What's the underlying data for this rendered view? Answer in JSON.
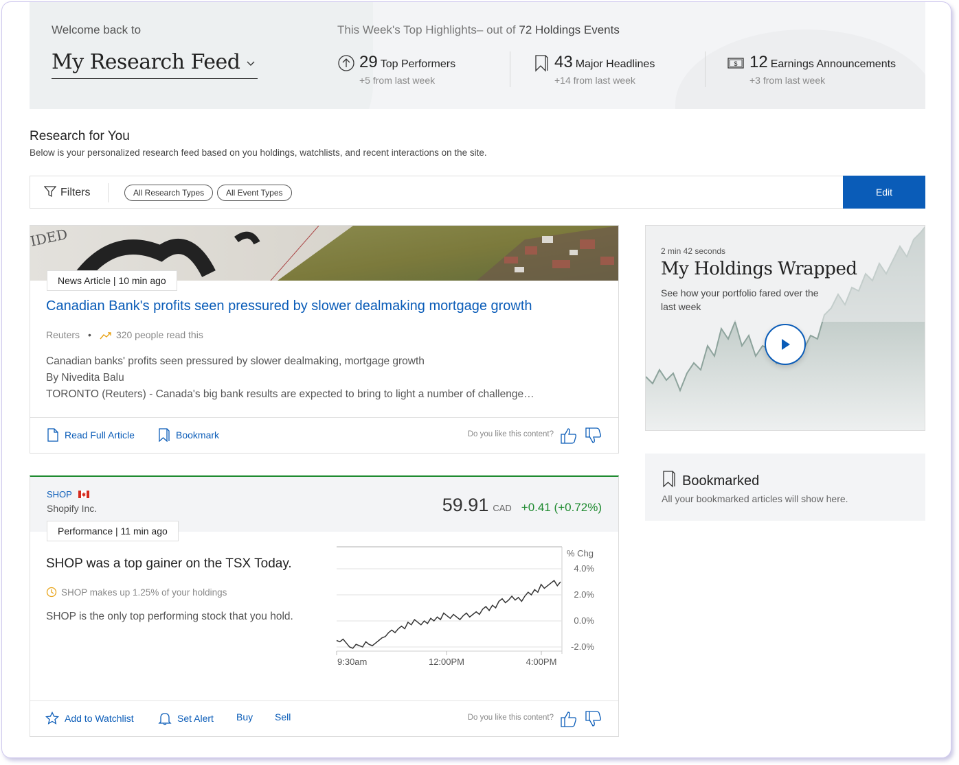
{
  "header": {
    "welcome": "Welcome back to",
    "feed_title": "My Research Feed",
    "highlights_prefix": "This Week's Top Highlights– out of",
    "highlights_count": "72 Holdings Events",
    "stats": [
      {
        "icon": "arrow-up-circle-icon",
        "number": "29",
        "label": "Top Performers",
        "sub": "+5 from last week"
      },
      {
        "icon": "bookmark-icon",
        "number": "43",
        "label": "Major Headlines",
        "sub": "+14 from last week"
      },
      {
        "icon": "dollar-bill-icon",
        "number": "12",
        "label": "Earnings Announcements",
        "sub": "+3 from last week"
      }
    ]
  },
  "research": {
    "title": "Research for You",
    "description": "Below is your personalized research feed based on you holdings, watchlists, and recent interactions on the site."
  },
  "filters": {
    "label": "Filters",
    "chips": [
      "All Research Types",
      "All Event Types"
    ],
    "edit_label": "Edit"
  },
  "news_card": {
    "tag": "News Article | 10 min ago",
    "headline": "Canadian Bank's profits seen pressured by slower dealmaking mortgage growth",
    "source": "Reuters",
    "readers": "320 people read this",
    "body_lines": [
      "Canadian banks' profits seen pressured by slower dealmaking, mortgage growth",
      "By Nivedita Balu",
      "TORONTO (Reuters) - Canada's big bank results are expected to bring to light a number of challenge…"
    ],
    "actions": {
      "read": "Read Full Article",
      "bookmark": "Bookmark"
    },
    "like_question": "Do you like this content?"
  },
  "stock_card": {
    "ticker": "SHOP",
    "company": "Shopify Inc.",
    "price": "59.91",
    "currency": "CAD",
    "change": "+0.41 (+0.72%)",
    "tag": "Performance | 11 min ago",
    "claim": "SHOP was a top gainer on the TSX Today.",
    "holding_note": "SHOP makes up 1.25% of your holdings",
    "description": "SHOP is the only top performing stock that you hold.",
    "actions": {
      "watchlist": "Add to Watchlist",
      "alert": "Set Alert",
      "buy": "Buy",
      "sell": "Sell"
    },
    "like_question": "Do you like this content?",
    "colors": {
      "positive": "#1e8a2f",
      "accent": "#0a5cb8"
    }
  },
  "chart_data": {
    "type": "line",
    "ylabel": "% Chg",
    "y_ticks": [
      "4.0%",
      "2.0%",
      "0.0%",
      "-2.0%"
    ],
    "x_ticks": [
      "9:30am",
      "12:00PM",
      "4:00PM"
    ],
    "ylim": [
      -2.0,
      4.0
    ],
    "values": [
      -1.5,
      -1.6,
      -1.4,
      -1.7,
      -2.0,
      -2.1,
      -1.8,
      -1.9,
      -2.0,
      -1.6,
      -1.8,
      -1.9,
      -1.7,
      -1.5,
      -1.3,
      -1.2,
      -0.9,
      -0.7,
      -0.9,
      -0.6,
      -0.4,
      -0.6,
      -0.1,
      -0.3,
      0.1,
      -0.1,
      -0.3,
      0.0,
      -0.2,
      0.2,
      0.0,
      0.3,
      0.1,
      0.6,
      0.4,
      0.2,
      0.5,
      0.3,
      0.1,
      0.4,
      0.6,
      0.3,
      0.5,
      0.7,
      0.5,
      0.9,
      1.1,
      0.8,
      1.2,
      1.0,
      1.5,
      1.7,
      1.4,
      1.6,
      1.9,
      1.6,
      1.8,
      1.5,
      1.9,
      2.2,
      2.0,
      2.4,
      2.2,
      2.8,
      2.5,
      2.7,
      2.9,
      3.1,
      2.7,
      3.0
    ]
  },
  "video_card": {
    "duration": "2 min 42 seconds",
    "title": "My Holdings Wrapped",
    "description": "See how your portfolio fared over the last week"
  },
  "bookmarked": {
    "title": "Bookmarked",
    "description": "All your bookmarked articles will show here."
  }
}
